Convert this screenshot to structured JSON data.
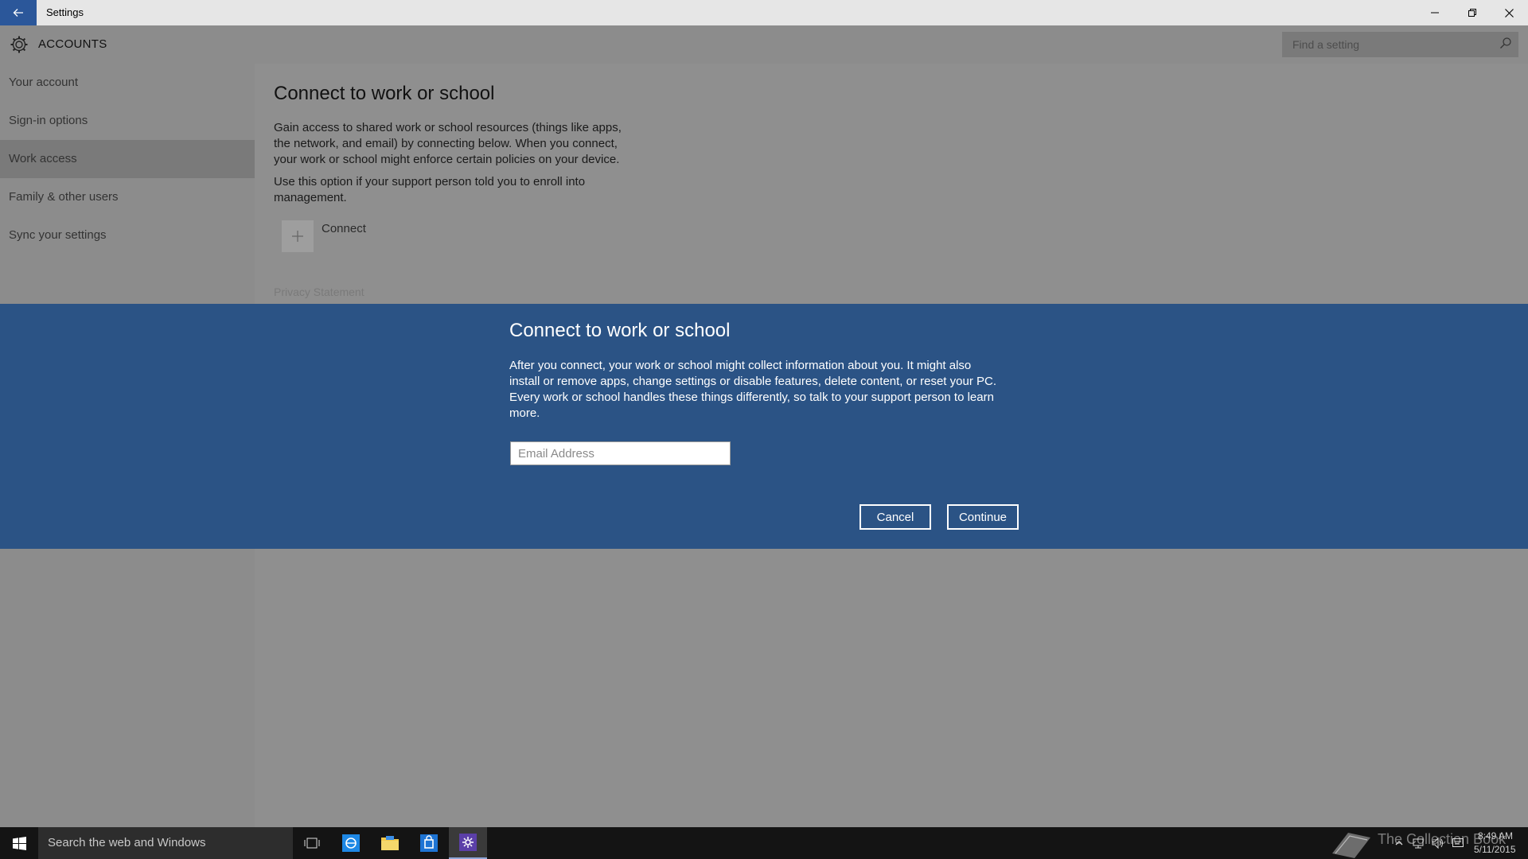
{
  "window": {
    "title": "Settings",
    "minimize": "–",
    "restore": "❐",
    "close": "✕"
  },
  "header": {
    "title": "ACCOUNTS",
    "search_placeholder": "Find a setting"
  },
  "sidebar": {
    "items": [
      {
        "label": "Your account",
        "selected": false
      },
      {
        "label": "Sign-in options",
        "selected": false
      },
      {
        "label": "Work access",
        "selected": true
      },
      {
        "label": "Family & other users",
        "selected": false
      },
      {
        "label": "Sync your settings",
        "selected": false
      }
    ]
  },
  "main": {
    "title": "Connect to work or school",
    "description": "Gain access to shared work or school resources (things like apps, the network, and email) by connecting below. When you connect, your work or school might enforce certain policies on your device.",
    "enroll_note": "Use this option if your support person told you to enroll into management.",
    "connect_label": "Connect",
    "privacy_link": "Privacy Statement"
  },
  "dialog": {
    "title": "Connect to work or school",
    "body": "After you connect, your work or school might collect information about you. It might also install or remove apps, change settings or disable features, delete content, or reset your PC. Every work or school handles these things differently, so talk to your support person to learn more.",
    "email_placeholder": "Email Address",
    "email_value": "",
    "cancel_label": "Cancel",
    "continue_label": "Continue"
  },
  "taskbar": {
    "search_text": "Search the web and Windows",
    "pinned": [
      "task-view-icon",
      "ie-icon",
      "file-explorer-icon",
      "store-icon",
      "settings-icon"
    ],
    "watermark_text": "The Collection Book",
    "time": "8:49 AM",
    "date": "5/11/2015"
  },
  "colors": {
    "accent": "#2b579a",
    "dialog_bg": "#2b5385",
    "taskbar_bg": "#141414"
  }
}
